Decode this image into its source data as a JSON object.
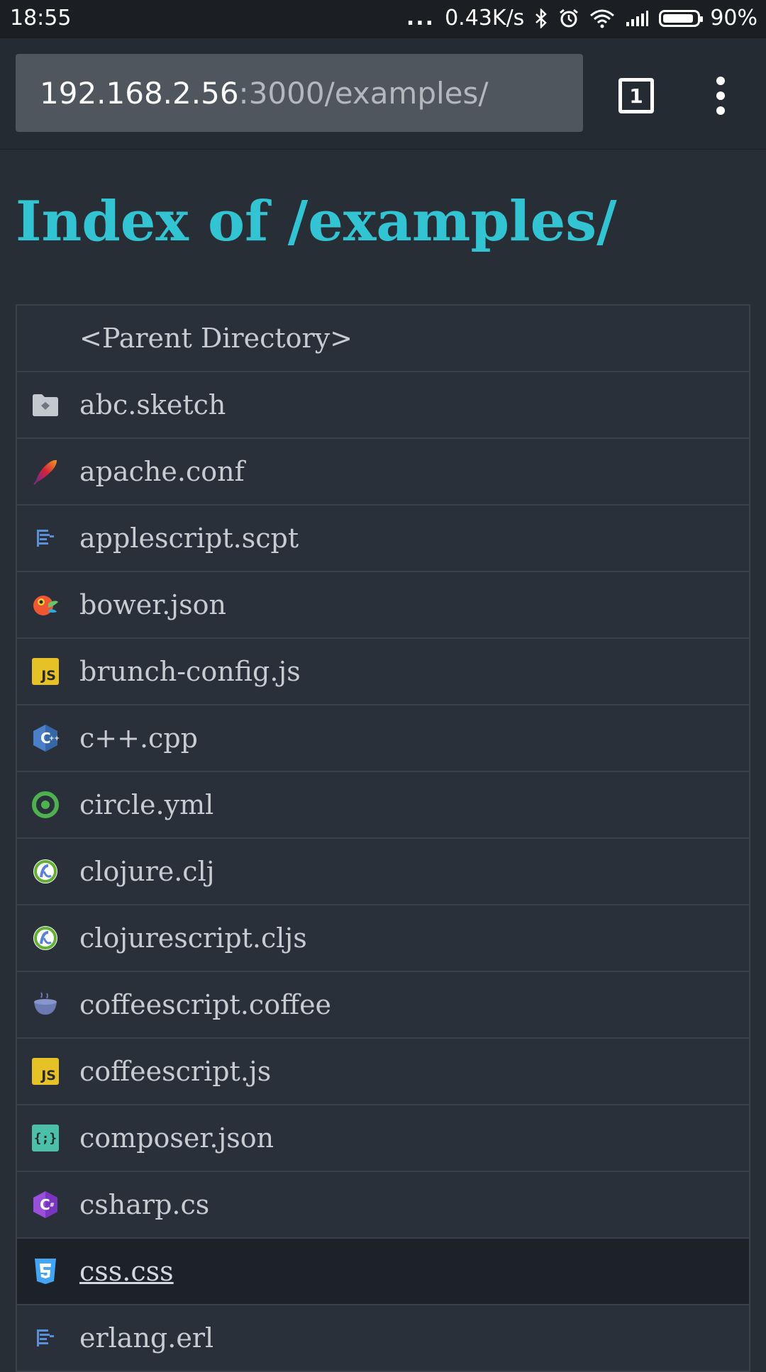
{
  "status_bar": {
    "time": "18:55",
    "dots": "...",
    "network_speed": "0.43K/s",
    "battery_percent": "90%",
    "battery_level": 0.9
  },
  "browser": {
    "url_host": "192.168.2.56",
    "url_path": ":3000/examples/",
    "tab_count": "1"
  },
  "page": {
    "title": "Index of /examples/",
    "accent_color": "#33c4d3"
  },
  "files": [
    {
      "name": "<Parent Directory>",
      "icon": "none"
    },
    {
      "name": "abc.sketch",
      "icon": "folder-icon"
    },
    {
      "name": "apache.conf",
      "icon": "apache-feather-icon"
    },
    {
      "name": "applescript.scpt",
      "icon": "script-file-icon"
    },
    {
      "name": "bower.json",
      "icon": "bower-icon"
    },
    {
      "name": "brunch-config.js",
      "icon": "js-icon"
    },
    {
      "name": "c++.cpp",
      "icon": "cpp-icon"
    },
    {
      "name": "circle.yml",
      "icon": "circleci-icon"
    },
    {
      "name": "clojure.clj",
      "icon": "clojure-icon"
    },
    {
      "name": "clojurescript.cljs",
      "icon": "clojure-icon"
    },
    {
      "name": "coffeescript.coffee",
      "icon": "coffee-cup-icon"
    },
    {
      "name": "coffeescript.js",
      "icon": "js-icon"
    },
    {
      "name": "composer.json",
      "icon": "composer-icon"
    },
    {
      "name": "csharp.cs",
      "icon": "csharp-icon"
    },
    {
      "name": "css.css",
      "icon": "css3-icon",
      "highlighted": true
    },
    {
      "name": "erlang.erl",
      "icon": "script-file-icon"
    }
  ]
}
